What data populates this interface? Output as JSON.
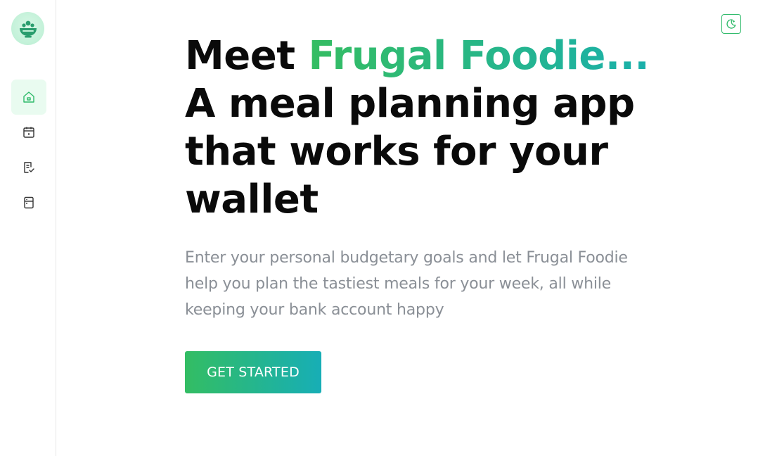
{
  "sidebar": {
    "logo_icon": "salad-bowl-icon",
    "items": [
      {
        "icon": "home-icon",
        "active": true
      },
      {
        "icon": "calendar-icon",
        "active": false
      },
      {
        "icon": "checklist-icon",
        "active": false
      },
      {
        "icon": "fridge-icon",
        "active": false
      }
    ]
  },
  "header": {
    "theme_toggle_icon": "moon-icon"
  },
  "hero": {
    "headline_prefix": "Meet ",
    "brand_name": "Frugal Foodie...",
    "headline_rest": "A meal planning app that works for your wallet",
    "subtitle": "Enter your personal budgetary goals and let Frugal Foodie help you plan the tastiest meals for your week, all while keeping your bank account happy",
    "cta_label": "GET STARTED"
  },
  "colors": {
    "accent_green": "#35bd62",
    "accent_teal": "#1ab0ab",
    "text_dark": "#0a0a0a",
    "text_muted": "#8a8f96"
  }
}
